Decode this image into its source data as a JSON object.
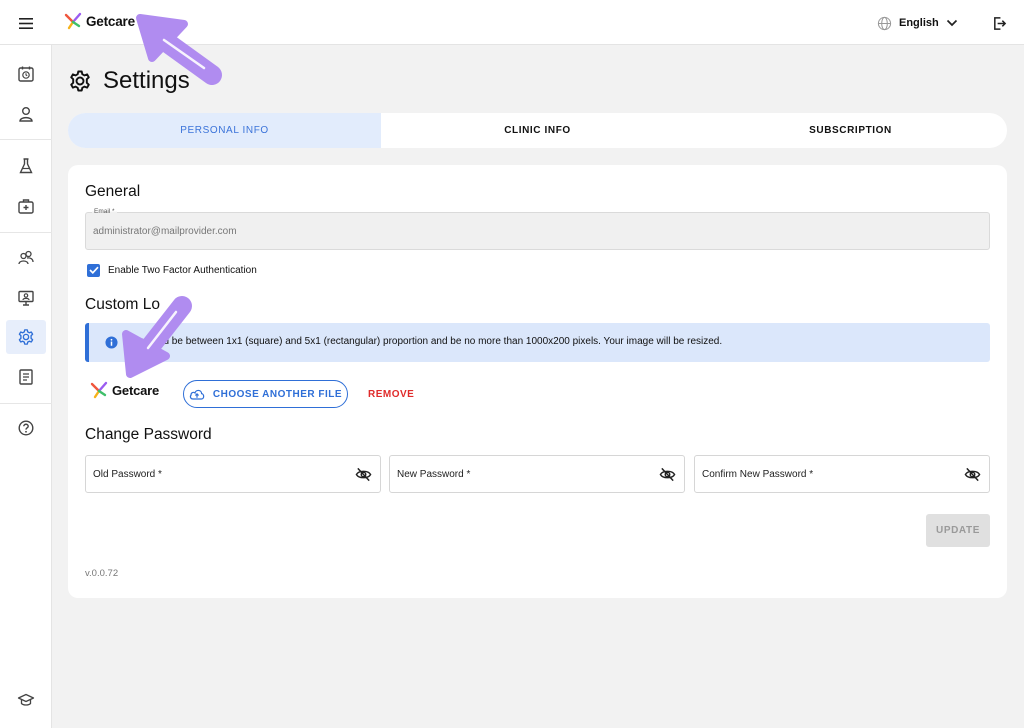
{
  "topbar": {
    "brand": "Getcare",
    "language": "English"
  },
  "sidebar": {
    "items": [
      {
        "name": "appointments-icon"
      },
      {
        "name": "user-icon"
      },
      {
        "name": "flask-icon"
      },
      {
        "name": "medical-kit-icon"
      },
      {
        "name": "users-icon"
      },
      {
        "name": "monitor-user-icon"
      },
      {
        "name": "gear-icon",
        "active": true
      },
      {
        "name": "document-icon"
      },
      {
        "name": "help-icon"
      },
      {
        "name": "graduation-cap-icon"
      }
    ]
  },
  "page": {
    "title": "Settings"
  },
  "tabs": [
    {
      "label": "PERSONAL INFO",
      "active": true
    },
    {
      "label": "CLINIC INFO"
    },
    {
      "label": "SUBSCRIPTION"
    }
  ],
  "general": {
    "heading": "General",
    "email_label": "Email *",
    "email_value": "administrator@mailprovider.com",
    "two_factor_label": "Enable Two Factor Authentication",
    "two_factor_checked": true
  },
  "custom_logo": {
    "heading": "Custom Lo",
    "info_text": "e    uld be between 1x1 (square) and 5x1 (rectangular) proportion and be no more than 1000x200 pixels. Your image will be resized.",
    "logo_text": "Getcare",
    "choose_label": "CHOOSE ANOTHER FILE",
    "remove_label": "REMOVE"
  },
  "password": {
    "heading": "Change Password",
    "old_label": "Old Password *",
    "new_label": "New Password *",
    "confirm_label": "Confirm New Password *",
    "update_label": "UPDATE"
  },
  "version": "v.0.0.72",
  "colors": {
    "accent": "#2f6fd7",
    "danger": "#e02b2b",
    "annotation": "#b08cf0",
    "tab_active_bg": "#e2ecfc"
  }
}
